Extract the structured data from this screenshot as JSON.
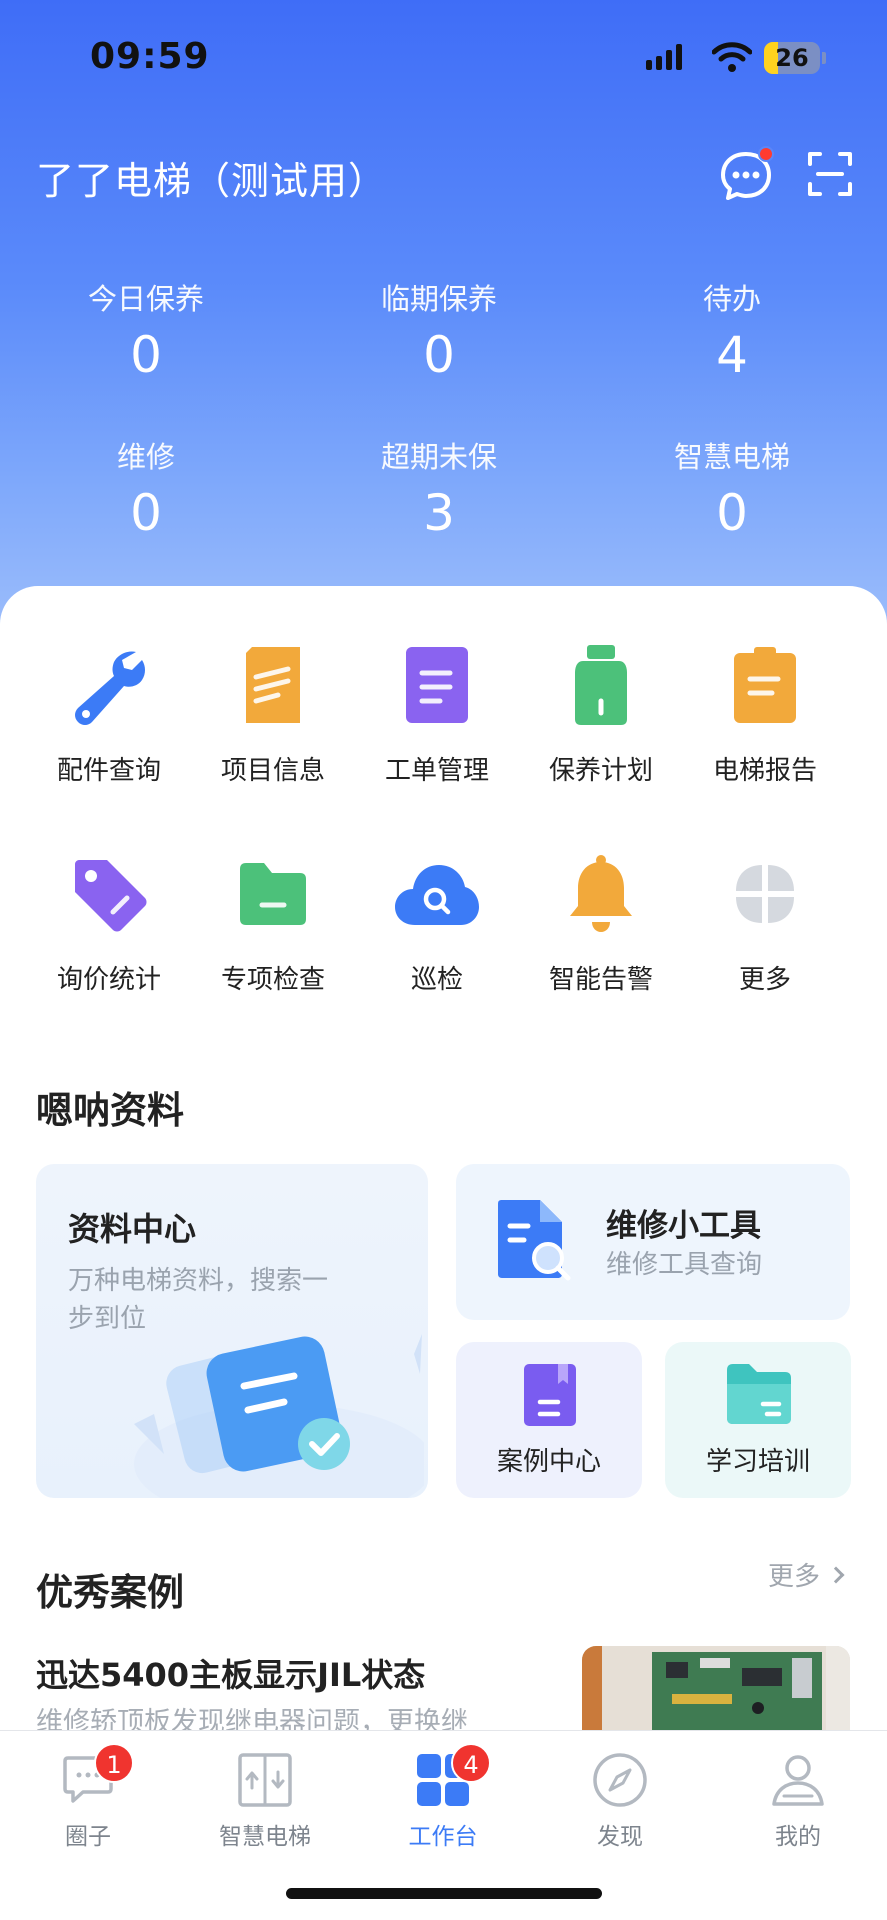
{
  "status_bar": {
    "time": "09:59",
    "battery": "26"
  },
  "header": {
    "title": "了了电梯（测试用）",
    "message_icon": "chat-bubble-icon",
    "scan_icon": "scan-icon"
  },
  "stats": [
    {
      "label": "今日保养",
      "value": "0"
    },
    {
      "label": "临期保养",
      "value": "0"
    },
    {
      "label": "待办",
      "value": "4"
    },
    {
      "label": "维修",
      "value": "0"
    },
    {
      "label": "超期未保",
      "value": "3"
    },
    {
      "label": "智慧电梯",
      "value": "0"
    }
  ],
  "grid": [
    {
      "label": "配件查询",
      "icon": "wrench-icon"
    },
    {
      "label": "项目信息",
      "icon": "document-icon"
    },
    {
      "label": "工单管理",
      "icon": "work-order-icon"
    },
    {
      "label": "保养计划",
      "icon": "bottle-icon"
    },
    {
      "label": "电梯报告",
      "icon": "clipboard-icon"
    },
    {
      "label": "询价统计",
      "icon": "price-tag-icon"
    },
    {
      "label": "专项检查",
      "icon": "folder-icon"
    },
    {
      "label": "巡检",
      "icon": "cloud-search-icon"
    },
    {
      "label": "智能告警",
      "icon": "bell-icon"
    },
    {
      "label": "更多",
      "icon": "more-grid-icon"
    }
  ],
  "resources": {
    "title": "嗯呐资料",
    "center": {
      "title": "资料中心",
      "desc": "万种电梯资料，搜索一步到位"
    },
    "tools": {
      "title": "维修小工具",
      "desc": "维修工具查询"
    },
    "cases": {
      "title": "案例中心"
    },
    "training": {
      "title": "学习培训"
    }
  },
  "cases": {
    "title": "优秀案例",
    "more": "更多",
    "items": [
      {
        "title": "迅达5400主板显示JIL状态",
        "desc": "维修轿顶板发现继电器问题，更换继"
      }
    ]
  },
  "tabbar": [
    {
      "label": "圈子",
      "badge": "1",
      "icon": "chat-icon"
    },
    {
      "label": "智慧电梯",
      "icon": "elevator-icon"
    },
    {
      "label": "工作台",
      "badge": "4",
      "icon": "workbench-icon"
    },
    {
      "label": "发现",
      "icon": "compass-icon"
    },
    {
      "label": "我的",
      "icon": "profile-icon"
    }
  ],
  "colors": {
    "primary": "#3c7bf6",
    "badge": "#f0342f"
  }
}
